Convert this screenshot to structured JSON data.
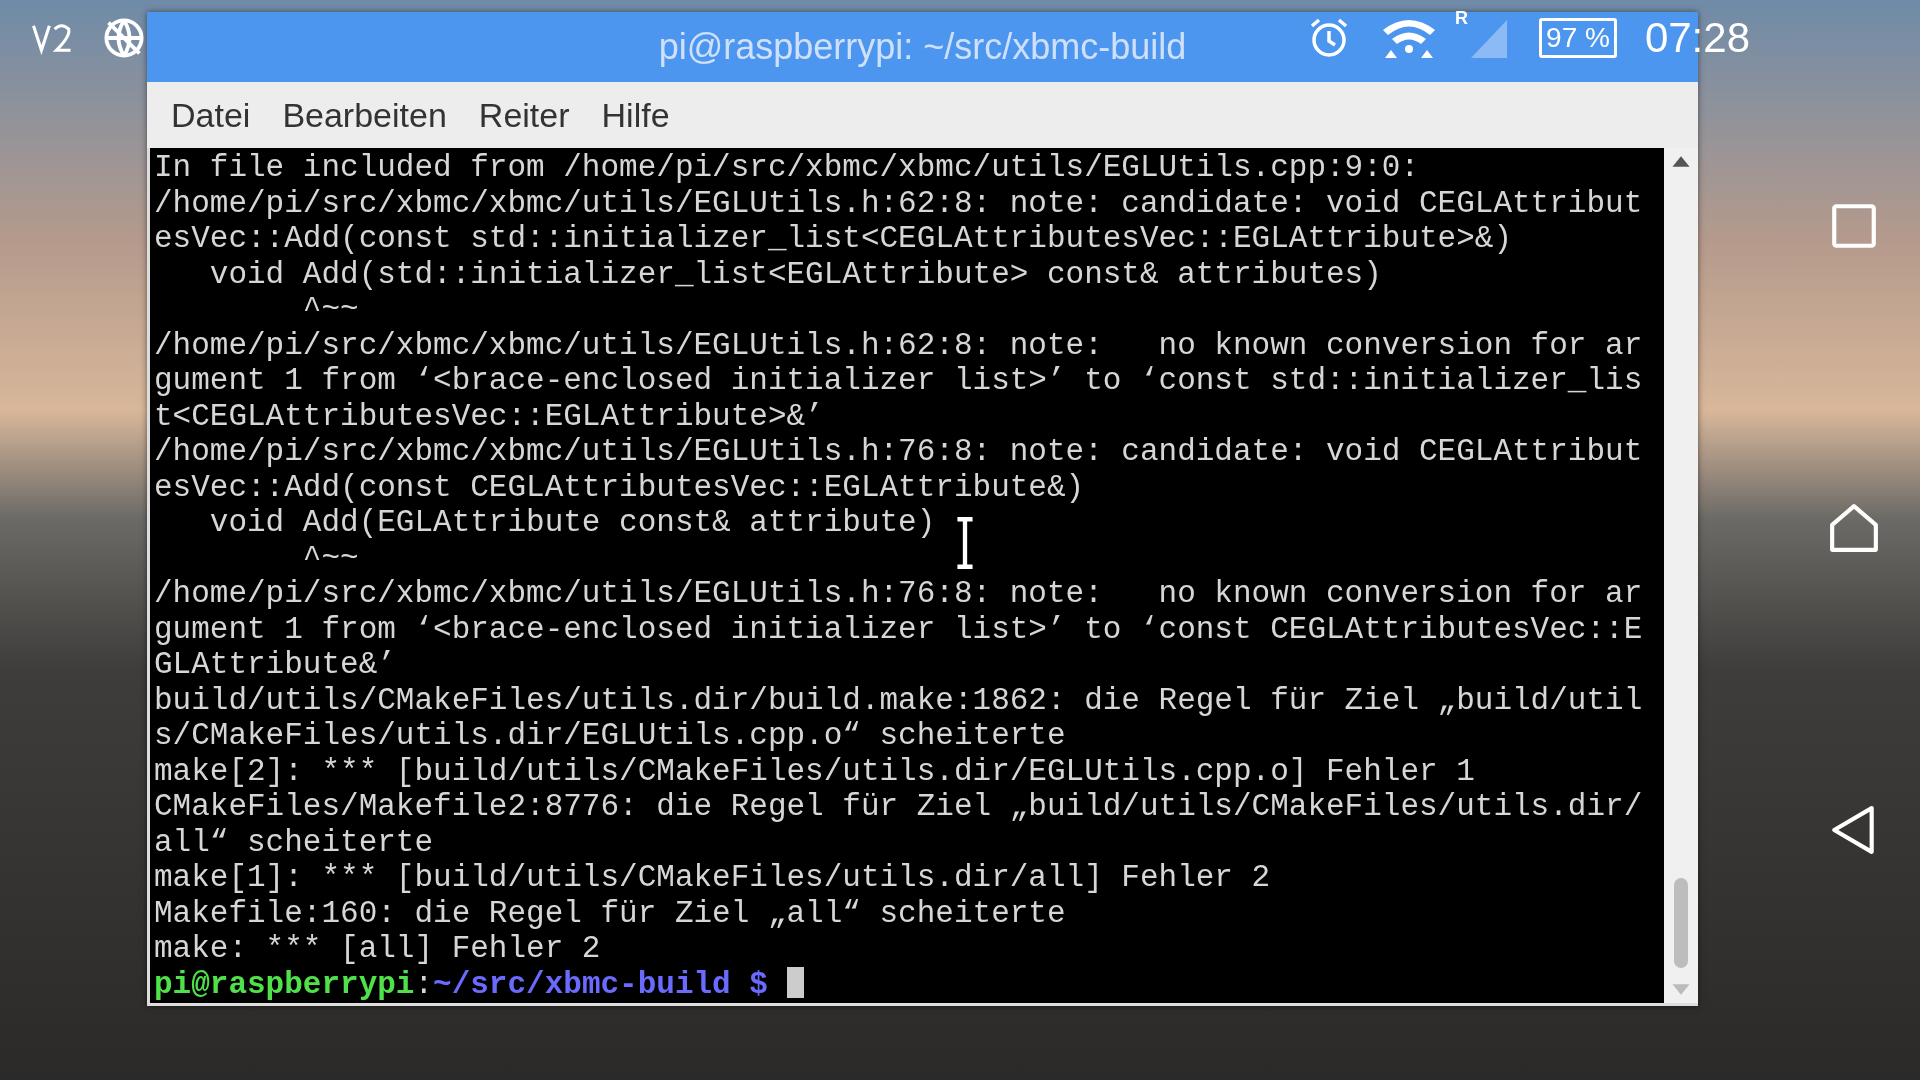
{
  "status_bar": {
    "roaming": "R",
    "battery": "97 %",
    "time": "07:28"
  },
  "window": {
    "title": "pi@raspberrypi: ~/src/xbmc-build"
  },
  "menu": [
    "Datei",
    "Bearbeiten",
    "Reiter",
    "Hilfe"
  ],
  "terminal": {
    "lines": [
      {
        "kind": "text",
        "text": "In file included from /home/pi/src/xbmc/xbmc/utils/EGLUtils.cpp:9:0:"
      },
      {
        "kind": "text",
        "text": "/home/pi/src/xbmc/xbmc/utils/EGLUtils.h:62:8: note: candidate: void CEGLAttribut"
      },
      {
        "kind": "text",
        "text": "esVec::Add(const std::initializer_list<CEGLAttributesVec::EGLAttribute>&)"
      },
      {
        "kind": "text",
        "text": "   void Add(std::initializer_list<EGLAttribute> const& attributes)"
      },
      {
        "kind": "text",
        "text": "        ^~~"
      },
      {
        "kind": "text",
        "text": "/home/pi/src/xbmc/xbmc/utils/EGLUtils.h:62:8: note:   no known conversion for ar"
      },
      {
        "kind": "text",
        "text": "gument 1 from ‘<brace-enclosed initializer list>’ to ‘const std::initializer_lis"
      },
      {
        "kind": "text",
        "text": "t<CEGLAttributesVec::EGLAttribute>&’"
      },
      {
        "kind": "text",
        "text": "/home/pi/src/xbmc/xbmc/utils/EGLUtils.h:76:8: note: candidate: void CEGLAttribut"
      },
      {
        "kind": "text",
        "text": "esVec::Add(const CEGLAttributesVec::EGLAttribute&)"
      },
      {
        "kind": "text",
        "text": "   void Add(EGLAttribute const& attribute)"
      },
      {
        "kind": "text",
        "text": "        ^~~"
      },
      {
        "kind": "text",
        "text": "/home/pi/src/xbmc/xbmc/utils/EGLUtils.h:76:8: note:   no known conversion for ar"
      },
      {
        "kind": "text",
        "text": "gument 1 from ‘<brace-enclosed initializer list>’ to ‘const CEGLAttributesVec::E"
      },
      {
        "kind": "text",
        "text": "GLAttribute&’"
      },
      {
        "kind": "text",
        "text": "build/utils/CMakeFiles/utils.dir/build.make:1862: die Regel für Ziel „build/util"
      },
      {
        "kind": "text",
        "text": "s/CMakeFiles/utils.dir/EGLUtils.cpp.o“ scheiterte"
      },
      {
        "kind": "text",
        "text": "make[2]: *** [build/utils/CMakeFiles/utils.dir/EGLUtils.cpp.o] Fehler 1"
      },
      {
        "kind": "text",
        "text": "CMakeFiles/Makefile2:8776: die Regel für Ziel „build/utils/CMakeFiles/utils.dir/"
      },
      {
        "kind": "text",
        "text": "all“ scheiterte"
      },
      {
        "kind": "text",
        "text": "make[1]: *** [build/utils/CMakeFiles/utils.dir/all] Fehler 2"
      },
      {
        "kind": "text",
        "text": "Makefile:160: die Regel für Ziel „all“ scheiterte"
      },
      {
        "kind": "text",
        "text": "make: *** [all] Fehler 2"
      },
      {
        "kind": "prompt",
        "user_host": "pi@raspberrypi",
        "separator": ":",
        "path": "~/src/xbmc-build",
        "symbol": "$"
      }
    ]
  }
}
